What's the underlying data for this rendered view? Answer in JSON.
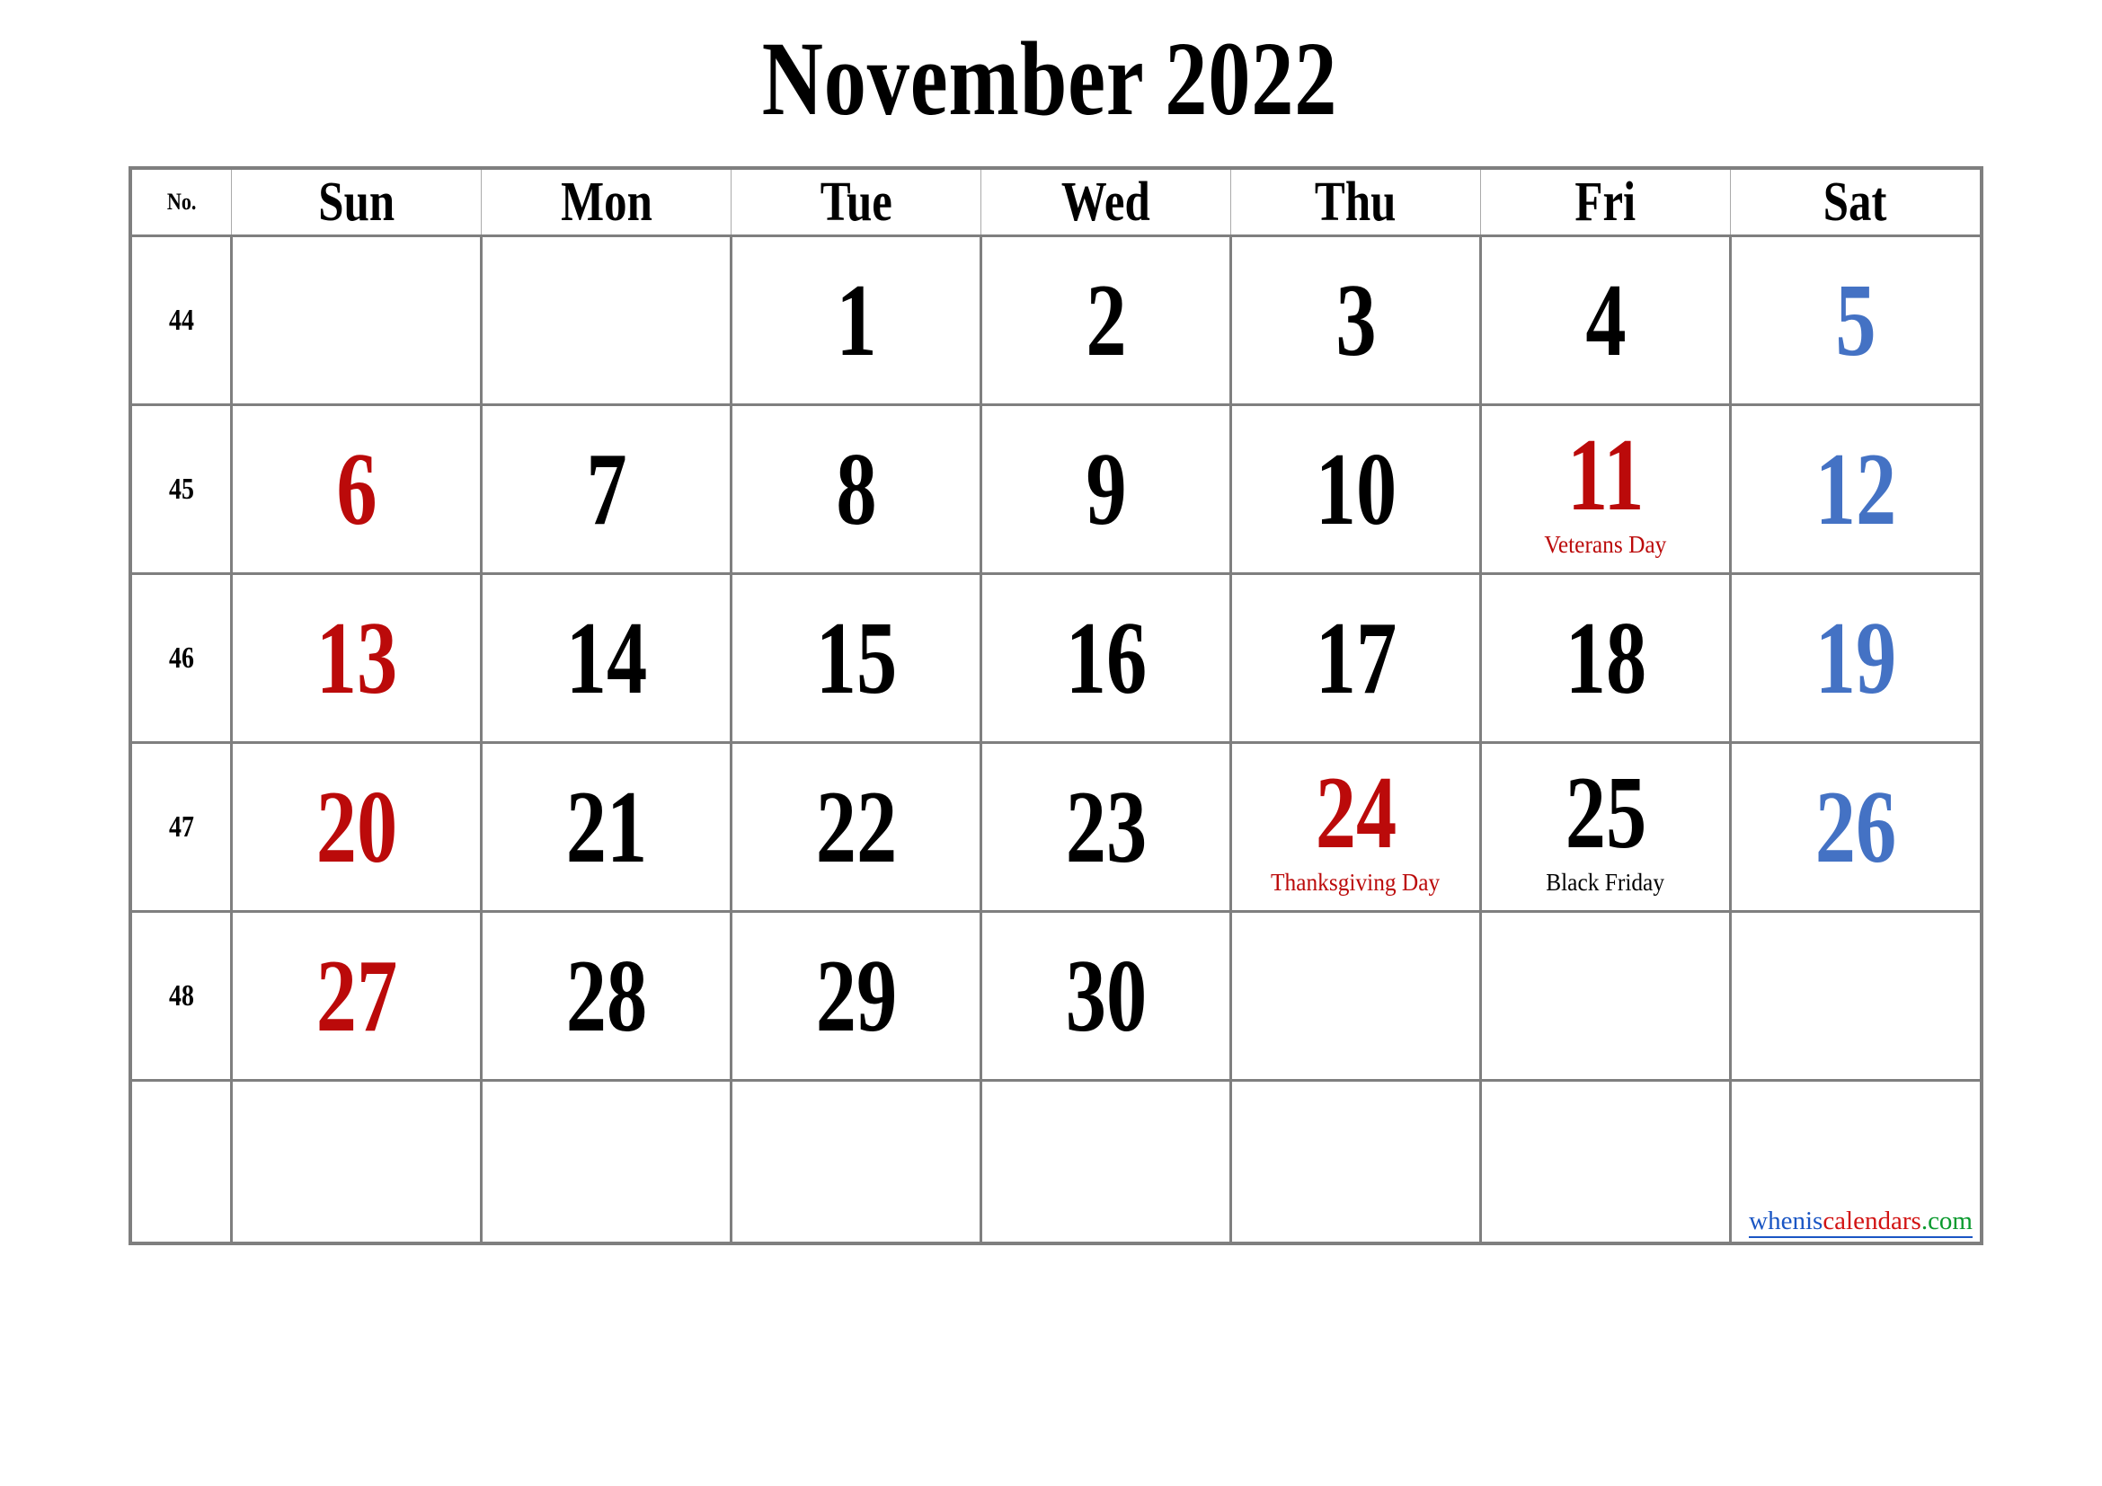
{
  "title": "November 2022",
  "table": {
    "week_col_header": "No.",
    "day_headers": [
      "Sun",
      "Mon",
      "Tue",
      "Wed",
      "Thu",
      "Fri",
      "Sat"
    ]
  },
  "colors": {
    "sunday": "#bb0a0a",
    "saturday": "#4472c4",
    "holiday": "#bb0a0a",
    "text": "#000000",
    "grid": "#7f7f7f",
    "link_blue": "#1a56c4",
    "link_red": "#d21313",
    "link_green": "#0a9a2e"
  },
  "weeks": [
    {
      "number": "44",
      "days": [
        {
          "num": "",
          "note": "",
          "kind": "empty"
        },
        {
          "num": "",
          "note": "",
          "kind": "empty"
        },
        {
          "num": "1",
          "note": "",
          "kind": "weekday"
        },
        {
          "num": "2",
          "note": "",
          "kind": "weekday"
        },
        {
          "num": "3",
          "note": "",
          "kind": "weekday"
        },
        {
          "num": "4",
          "note": "",
          "kind": "weekday"
        },
        {
          "num": "5",
          "note": "",
          "kind": "saturday"
        }
      ]
    },
    {
      "number": "45",
      "days": [
        {
          "num": "6",
          "note": "",
          "kind": "sunday"
        },
        {
          "num": "7",
          "note": "",
          "kind": "weekday"
        },
        {
          "num": "8",
          "note": "",
          "kind": "weekday"
        },
        {
          "num": "9",
          "note": "",
          "kind": "weekday"
        },
        {
          "num": "10",
          "note": "",
          "kind": "weekday"
        },
        {
          "num": "11",
          "note": "Veterans Day",
          "kind": "holiday"
        },
        {
          "num": "12",
          "note": "",
          "kind": "saturday"
        }
      ]
    },
    {
      "number": "46",
      "days": [
        {
          "num": "13",
          "note": "",
          "kind": "sunday"
        },
        {
          "num": "14",
          "note": "",
          "kind": "weekday"
        },
        {
          "num": "15",
          "note": "",
          "kind": "weekday"
        },
        {
          "num": "16",
          "note": "",
          "kind": "weekday"
        },
        {
          "num": "17",
          "note": "",
          "kind": "weekday"
        },
        {
          "num": "18",
          "note": "",
          "kind": "weekday"
        },
        {
          "num": "19",
          "note": "",
          "kind": "saturday"
        }
      ]
    },
    {
      "number": "47",
      "days": [
        {
          "num": "20",
          "note": "",
          "kind": "sunday"
        },
        {
          "num": "21",
          "note": "",
          "kind": "weekday"
        },
        {
          "num": "22",
          "note": "",
          "kind": "weekday"
        },
        {
          "num": "23",
          "note": "",
          "kind": "weekday"
        },
        {
          "num": "24",
          "note": "Thanksgiving Day",
          "kind": "holiday"
        },
        {
          "num": "25",
          "note": "Black Friday",
          "kind": "observance"
        },
        {
          "num": "26",
          "note": "",
          "kind": "saturday"
        }
      ]
    },
    {
      "number": "48",
      "days": [
        {
          "num": "27",
          "note": "",
          "kind": "sunday"
        },
        {
          "num": "28",
          "note": "",
          "kind": "weekday"
        },
        {
          "num": "29",
          "note": "",
          "kind": "weekday"
        },
        {
          "num": "30",
          "note": "",
          "kind": "weekday"
        },
        {
          "num": "",
          "note": "",
          "kind": "empty"
        },
        {
          "num": "",
          "note": "",
          "kind": "empty"
        },
        {
          "num": "",
          "note": "",
          "kind": "empty"
        }
      ]
    },
    {
      "number": "",
      "days": [
        {
          "num": "",
          "note": "",
          "kind": "empty"
        },
        {
          "num": "",
          "note": "",
          "kind": "empty"
        },
        {
          "num": "",
          "note": "",
          "kind": "empty"
        },
        {
          "num": "",
          "note": "",
          "kind": "empty"
        },
        {
          "num": "",
          "note": "",
          "kind": "empty"
        },
        {
          "num": "",
          "note": "",
          "kind": "empty"
        },
        {
          "num": "",
          "note": "",
          "kind": "empty"
        }
      ]
    }
  ],
  "credit": {
    "part1": "whenis",
    "part2": "calendars",
    "part3": ".com"
  }
}
